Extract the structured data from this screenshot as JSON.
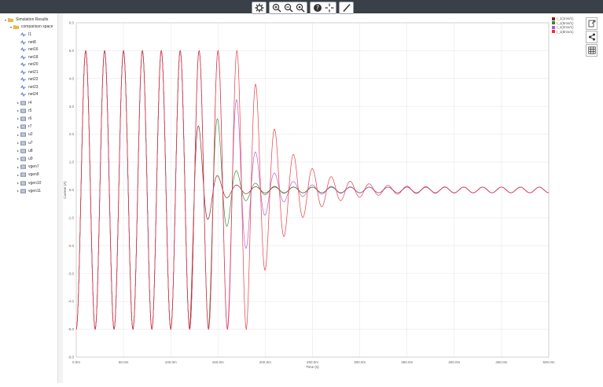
{
  "tree": {
    "root": "Simulation Results",
    "group": "comparison space",
    "signals": [
      "I1",
      "net8",
      "net16",
      "net18",
      "net20",
      "net21",
      "net22",
      "net23",
      "net24"
    ],
    "folders": [
      "r4",
      "r5",
      "r6",
      "r7",
      "u2",
      "u7",
      "u8",
      "u9",
      "vgen7",
      "vgen8",
      "vgen10",
      "vgen11"
    ]
  },
  "legend": [
    "I_1(1ms/1)",
    "I_1(5ms/1)",
    "I_1(2ms/1)",
    "I_1(8ms/1)"
  ],
  "colors": [
    "#8b1a1a",
    "#2e8b2e",
    "#bb55cc",
    "#e8333a"
  ],
  "toolbar": {
    "buttons": [
      "settings-icon",
      "zoom-in-icon",
      "zoom-out-icon",
      "zoom-fit-icon",
      "help-icon",
      "crosshair-icon",
      "pen-icon"
    ]
  },
  "side_buttons": [
    "export-icon",
    "share-icon",
    "table-icon"
  ],
  "chart_data": {
    "type": "line",
    "xlabel": "Time (s)",
    "ylabel": "Current (A)",
    "xlim": [
      0,
      0.5
    ],
    "ylim": [
      -6,
      6
    ],
    "x_ticks": [
      "0.0m",
      "50.0m",
      "100.0m",
      "150.0m",
      "200.0m",
      "250.0m",
      "300.0m",
      "350.0m",
      "400.0m",
      "450.0m",
      "500.0m"
    ],
    "y_ticks": [
      "6.0",
      "5.0",
      "4.0",
      "3.0",
      "2.0",
      "1.0",
      "0.0",
      "-1.0",
      "-2.0",
      "-3.0",
      "-4.0",
      "-5.0",
      "-6.0"
    ],
    "signal": {
      "frequency_hz": 50,
      "amplitude": 5.0,
      "final_amplitude": 0.1,
      "phase_deg": -90
    },
    "series": [
      {
        "name": "I_1(1ms/1)",
        "decay_start": 0.12,
        "decay_tau": 0.012
      },
      {
        "name": "I_1(5ms/1)",
        "decay_start": 0.14,
        "decay_tau": 0.014
      },
      {
        "name": "I_1(2ms/1)",
        "decay_start": 0.16,
        "decay_tau": 0.022
      },
      {
        "name": "I_1(8ms/1)",
        "decay_start": 0.18,
        "decay_tau": 0.035
      }
    ]
  }
}
